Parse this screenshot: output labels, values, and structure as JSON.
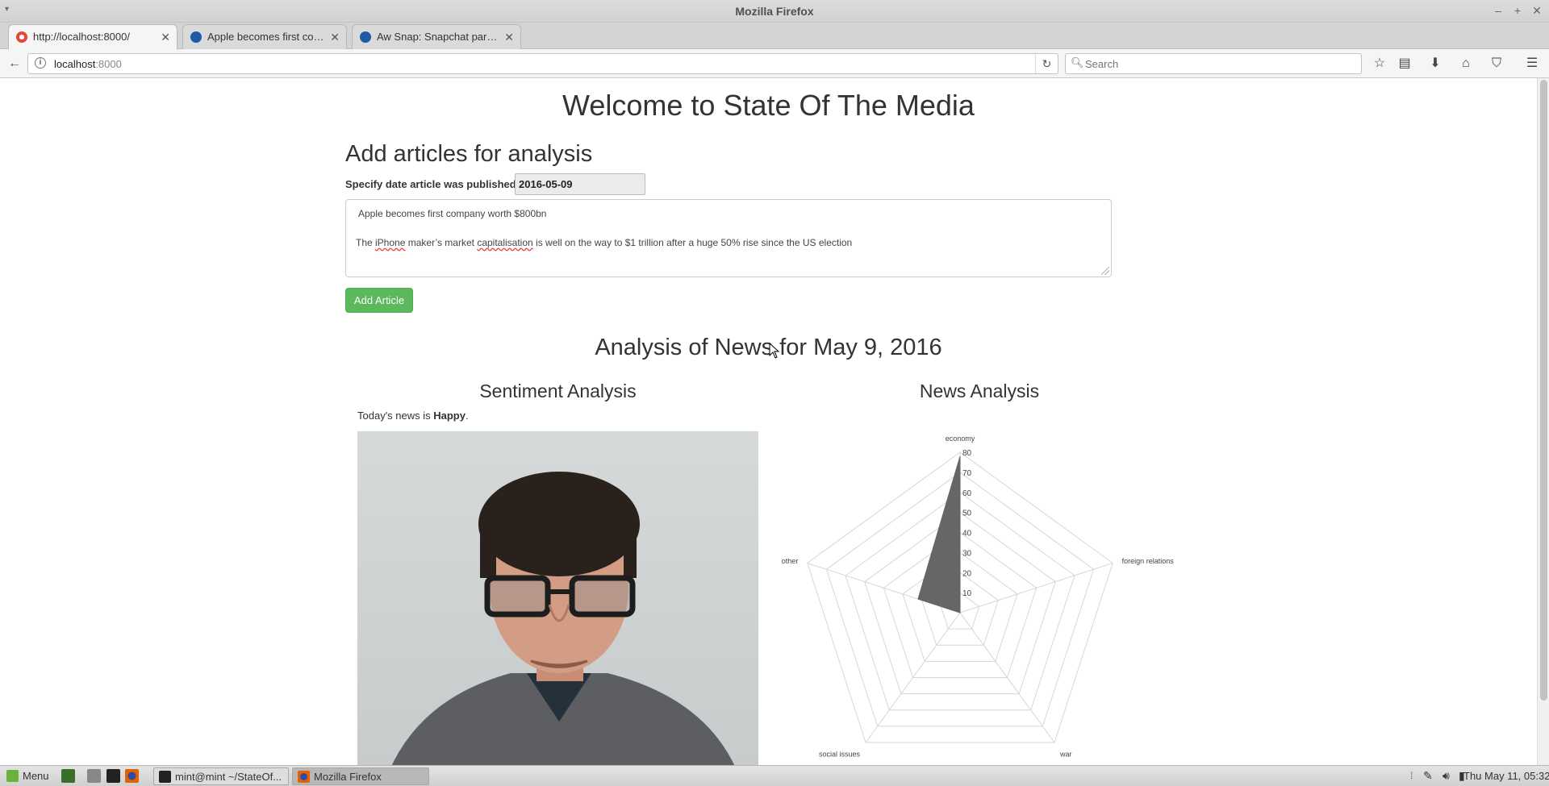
{
  "window": {
    "title": "Mozilla Firefox"
  },
  "tabs": [
    {
      "label": "http://localhost:8000/"
    },
    {
      "label": "Apple becomes first com..."
    },
    {
      "label": "Aw Snap: Snapchat paren..."
    }
  ],
  "navbar": {
    "url_host": "localhost",
    "url_port": ":8000",
    "search_placeholder": "Search"
  },
  "page": {
    "heading": "Welcome to State Of The Media",
    "add_section": {
      "title": "Add articles for analysis",
      "date_label": "Specify date article was published:",
      "date_value": "2016-05-09",
      "article": {
        "line1": "Apple becomes first company worth $800bn",
        "line2_pre": "The ",
        "line2_word1": "iPhone",
        "line2_mid": " maker’s market ",
        "line2_word2": "capitalisation",
        "line2_post": " is well on the way to $1 trillion after a huge 50% rise since the US election"
      },
      "button": "Add Article"
    },
    "analysis_title": "Analysis of News for May 9, 2016",
    "sentiment": {
      "title": "Sentiment Analysis",
      "prefix": "Today's news is ",
      "mood": "Happy",
      "suffix": "."
    },
    "news": {
      "title": "News Analysis"
    }
  },
  "chart_data": {
    "type": "radar",
    "axes": [
      "economy",
      "foreign relations",
      "war",
      "social issues",
      "other"
    ],
    "r_max": 80,
    "r_ticks": [
      10,
      20,
      30,
      40,
      50,
      60,
      70,
      80
    ],
    "series": [
      {
        "values": [
          78,
          0,
          0,
          0,
          22
        ]
      }
    ],
    "fill_color": "#666666"
  },
  "taskbar": {
    "menu": "Menu",
    "windows": [
      {
        "label": "mint@mint ~/StateOf..."
      },
      {
        "label": "Mozilla Firefox"
      }
    ],
    "clock": "Thu May 11, 05:32"
  }
}
